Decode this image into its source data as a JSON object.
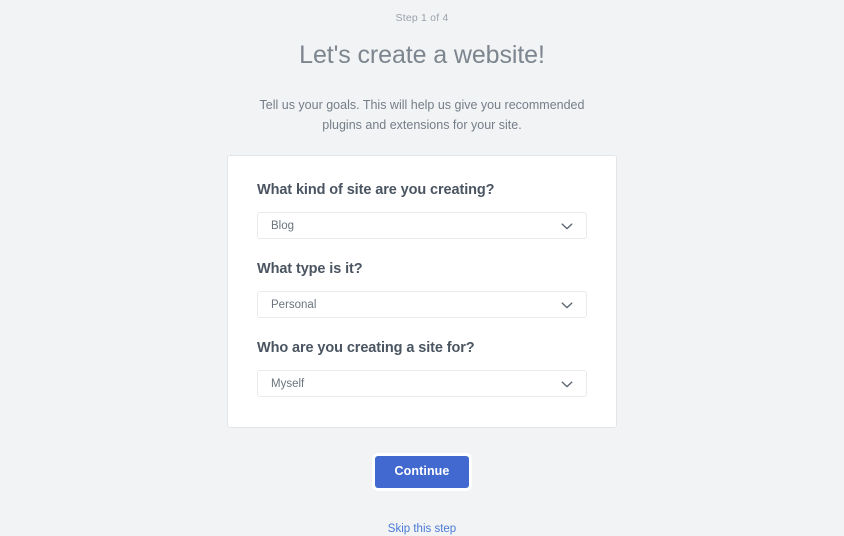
{
  "wizard": {
    "step_counter": "Step 1 of 4",
    "title": "Let's create a website!",
    "subtitle": "Tell us your goals. This will help us give you recommended plugins and extensions for your site.",
    "fields": [
      {
        "label": "What kind of site are you creating?",
        "value": "Blog",
        "icon": "chevron-down-icon"
      },
      {
        "label": "What type is it?",
        "value": "Personal",
        "icon": "chevron-down-icon"
      },
      {
        "label": "Who are you creating a site for?",
        "value": "Myself",
        "icon": "chevron-down-icon"
      }
    ],
    "continue_label": "Continue",
    "skip_label": "Skip this step",
    "colors": {
      "page_background": "#f1f3f5",
      "card_background": "#ffffff",
      "card_border": "#e2e6ea",
      "title_text": "#7d858e",
      "label_text": "#4a5561",
      "muted_text": "#757e88",
      "primary_button": "#4169cf",
      "link": "#4a7ad6"
    }
  }
}
